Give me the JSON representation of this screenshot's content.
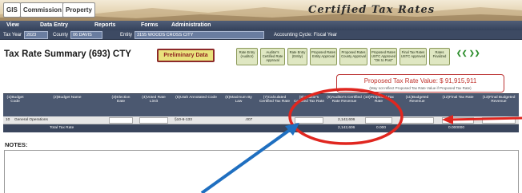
{
  "header": {
    "logos": [
      "GIS",
      "Commission",
      "Property"
    ],
    "product_title": "Certified Tax Rates"
  },
  "menu": {
    "items": [
      "View",
      "Data Entry",
      "Reports",
      "Forms",
      "Administration"
    ]
  },
  "selectors": {
    "tax_year_label": "Tax Year",
    "tax_year_value": "2023",
    "county_label": "County",
    "county_value": "06 DAVIS",
    "entity_label": "Entity",
    "entity_value": "3155 WOODS CROSS CITY",
    "accounting_cycle": "Accounting Cycle: Fiscal Year"
  },
  "page": {
    "title": "Tax Rate Summary (693) CTY",
    "status_button": "Preliminary Data"
  },
  "workflow_steps": [
    "Rate Entry (Auditor)",
    "Auditor's Certified Rate Approval",
    "Rate Entry (Entity)",
    "Proposed Rates Entity Approval",
    "Proposed Rates County Approval",
    "Proposed Rates USTC Approved \"OK to Post\"",
    "Final Tax Rates USTC Approved",
    "Rates Finalized"
  ],
  "proposed": {
    "value_text": "Proposed Tax Rate Value: $ 91,915,911",
    "note": "(May not reflect Proposed Tax Rate Value if Proposed Tax Rate)"
  },
  "table": {
    "columns": [
      {
        "num": "(1)",
        "label": "Budget Code"
      },
      {
        "num": "(2)",
        "label": "Budget Name"
      },
      {
        "num": "(3)",
        "label": "Election Date"
      },
      {
        "num": "(4)",
        "label": "Voted Rate Limit"
      },
      {
        "num": "(5)",
        "label": "Utah Annotated Code"
      },
      {
        "num": "(6)",
        "label": "Maximum By Law"
      },
      {
        "num": "(7)",
        "label": "Calculated Certified Tax Rate"
      },
      {
        "num": "(8)",
        "label": "Auditor's Certified Tax Rate"
      },
      {
        "num": "(9)",
        "label": "Auditor's Certified Rate Revenue"
      },
      {
        "num": "(10)",
        "label": "Proposed Tax Rate"
      },
      {
        "num": "(11)",
        "label": "Budgeted Revenue"
      },
      {
        "num": "(12)",
        "label": "Final Tax Rate"
      },
      {
        "num": "(13)",
        "label": "Final Budgeted Revenue"
      }
    ],
    "rows": [
      {
        "code": "10",
        "name": "General Operations",
        "utah_code": "§10-6-133",
        "max_by_law": ".007",
        "certified_revenue": "2,142,606"
      }
    ],
    "total": {
      "label": "Total Tax Rate",
      "certified_revenue": "2,142,606",
      "proposed_rate": "0.000",
      "final_rate": "0.000000"
    }
  },
  "notes": {
    "label": "NOTES:",
    "content": ""
  },
  "colors": {
    "menu_bg": "#35425b",
    "table_header": "#4b5870",
    "status_button_bg": "#e9e27c",
    "annotation_red": "#e0261f",
    "annotation_blue": "#1f6fc0"
  }
}
